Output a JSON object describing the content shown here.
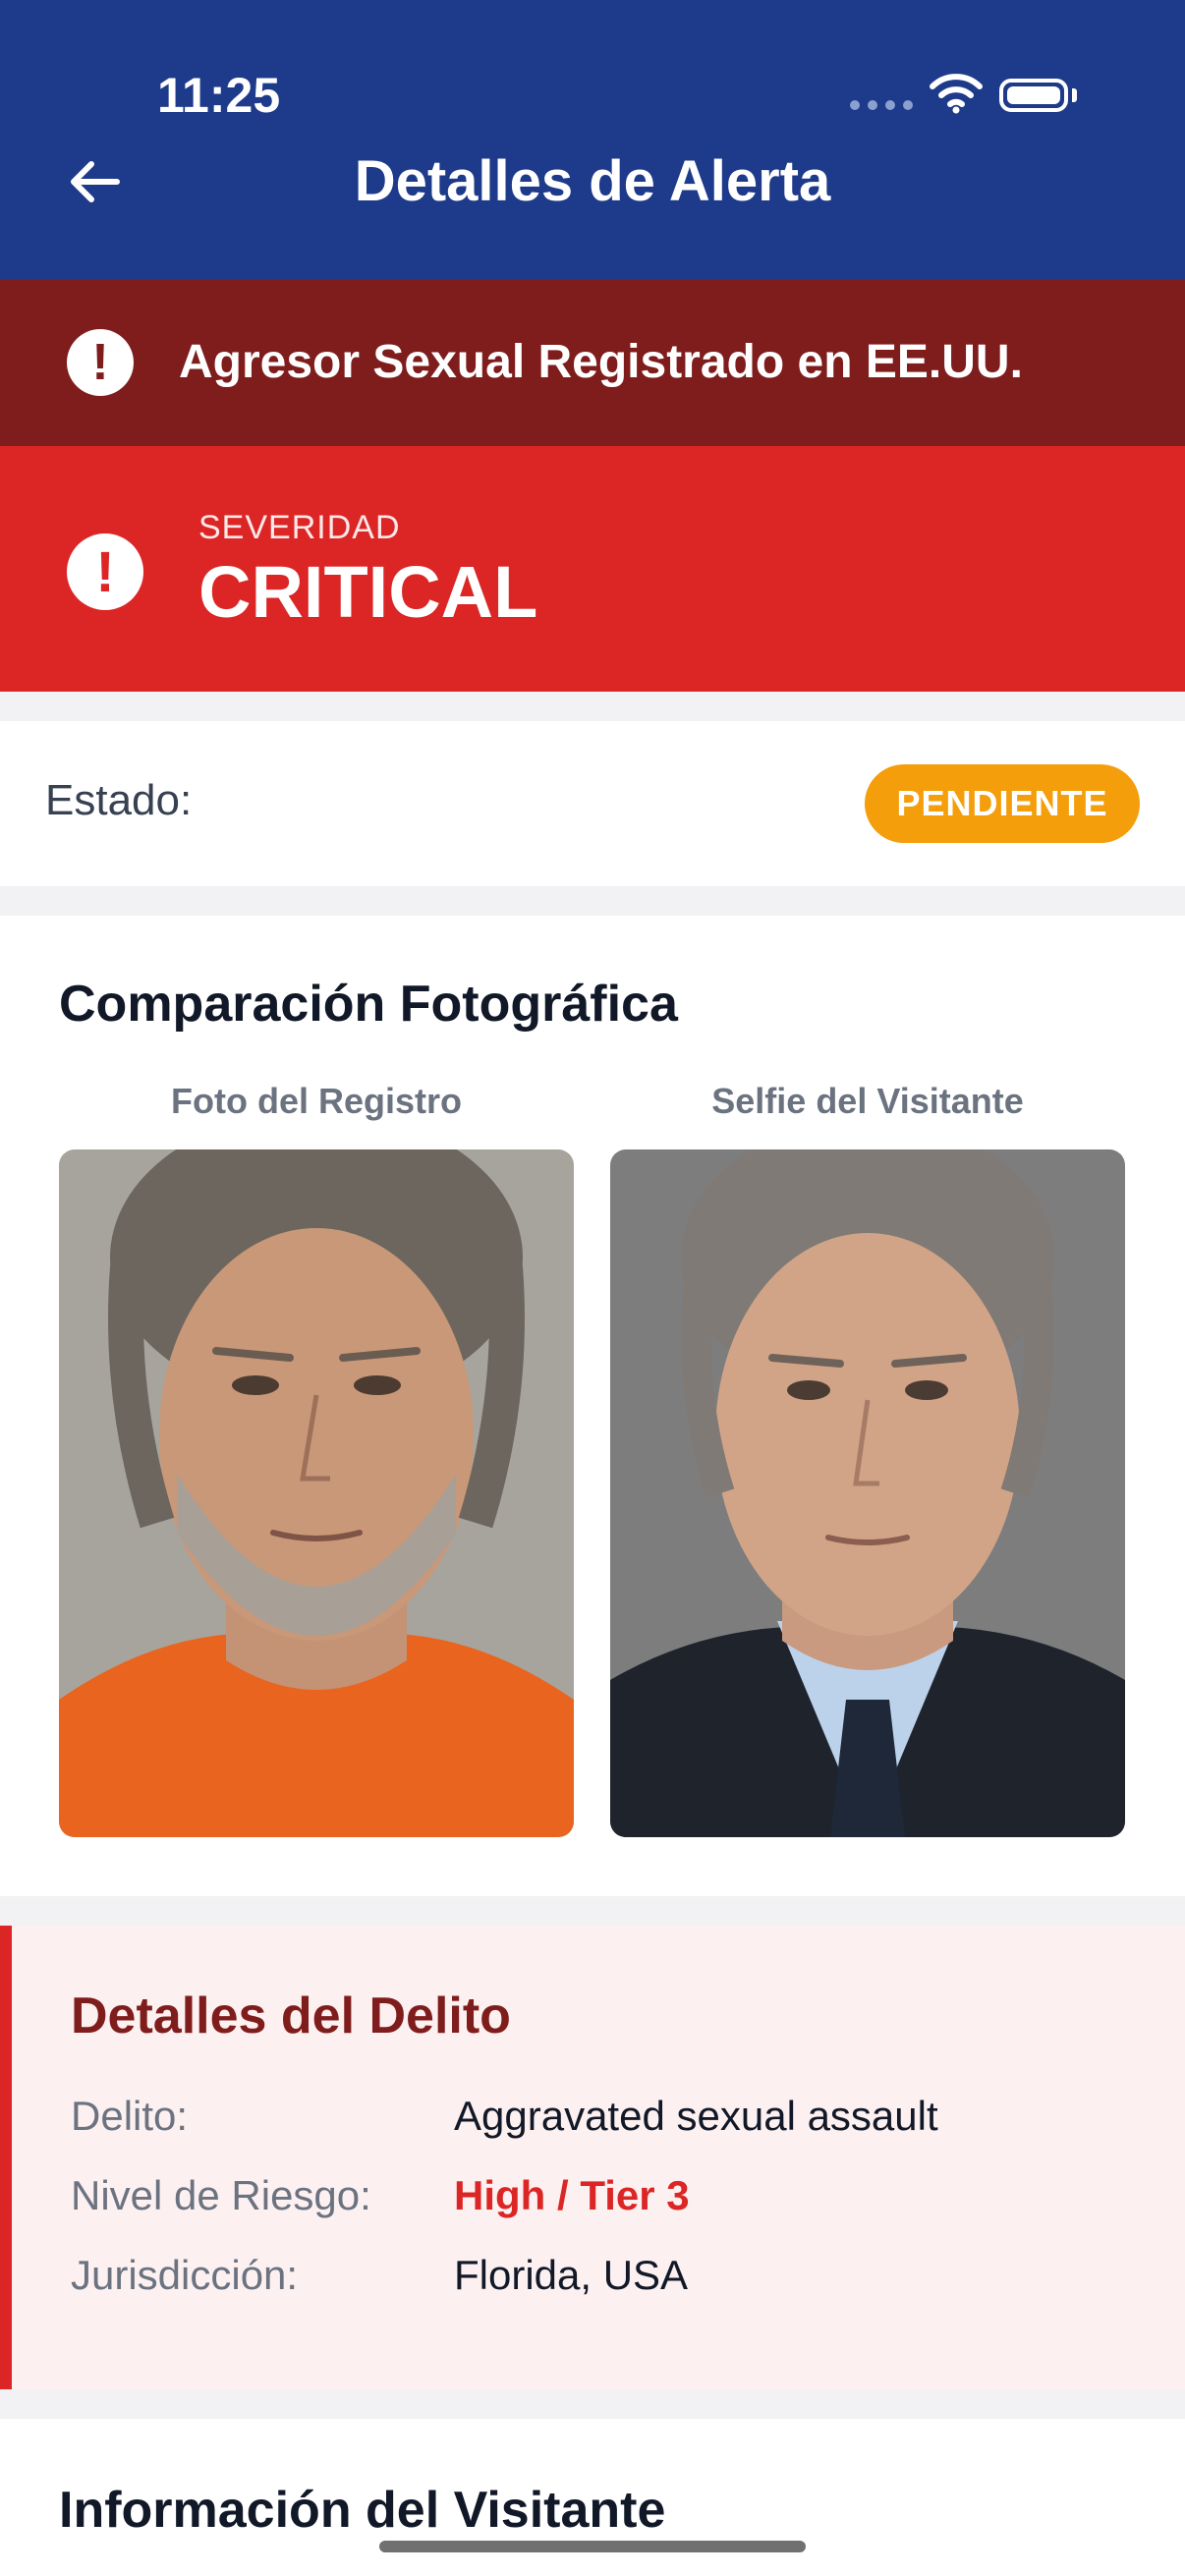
{
  "status_bar": {
    "time": "11:25"
  },
  "header": {
    "title": "Detalles de Alerta",
    "back_icon": "arrow-left-icon"
  },
  "alert_banner": {
    "text": "Agresor Sexual Registrado en EE.UU.",
    "icon": "exclamation-icon",
    "color": "#7f1d1d"
  },
  "severity": {
    "label": "SEVERIDAD",
    "value": "CRITICAL",
    "icon": "exclamation-icon",
    "color": "#dc2626"
  },
  "status": {
    "label": "Estado:",
    "badge": "PENDIENTE",
    "badge_color": "#f59e0b"
  },
  "photo_comparison": {
    "title": "Comparación Fotográfica",
    "registry_label": "Foto del Registro",
    "selfie_label": "Selfie del Visitante"
  },
  "crime_details": {
    "title": "Detalles del Delito",
    "rows": [
      {
        "label": "Delito:",
        "value": "Aggravated sexual assault"
      },
      {
        "label": "Nivel de Riesgo:",
        "value": "High / Tier 3"
      },
      {
        "label": "Jurisdicción:",
        "value": "Florida, USA"
      }
    ]
  },
  "visitor_info": {
    "title": "Información del Visitante"
  },
  "colors": {
    "header": "#1e3a8a",
    "accent_red": "#dc2626",
    "dark_red": "#7f1d1d",
    "pending": "#f59e0b"
  }
}
